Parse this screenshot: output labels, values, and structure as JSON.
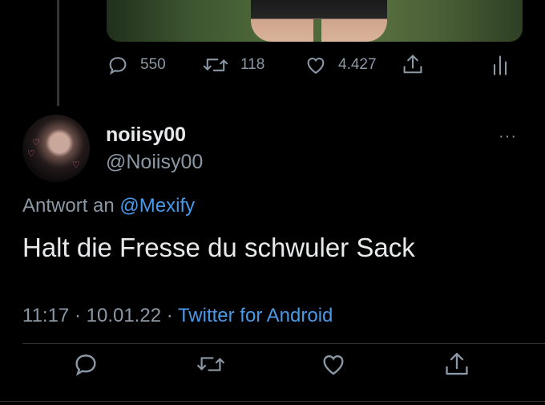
{
  "parent_tweet": {
    "actions": {
      "replies": "550",
      "retweets": "118",
      "likes": "4.427"
    }
  },
  "tweet": {
    "display_name": "noiisy00",
    "handle": "@Noiisy00",
    "reply_prefix": "Antwort an",
    "reply_mention": "@Mexify",
    "text": "Halt die Fresse du schwuler Sack",
    "time": "11:17",
    "separator": "·",
    "date": "10.01.22",
    "source": "Twitter for Android",
    "more_icon": "···"
  },
  "icons": [
    "reply-icon",
    "retweet-icon",
    "like-icon",
    "share-icon",
    "analytics-icon",
    "more-icon"
  ],
  "colors": {
    "background": "#000000",
    "text": "#e7e9ea",
    "secondary": "#8b98a5",
    "link": "#4a99e9"
  }
}
